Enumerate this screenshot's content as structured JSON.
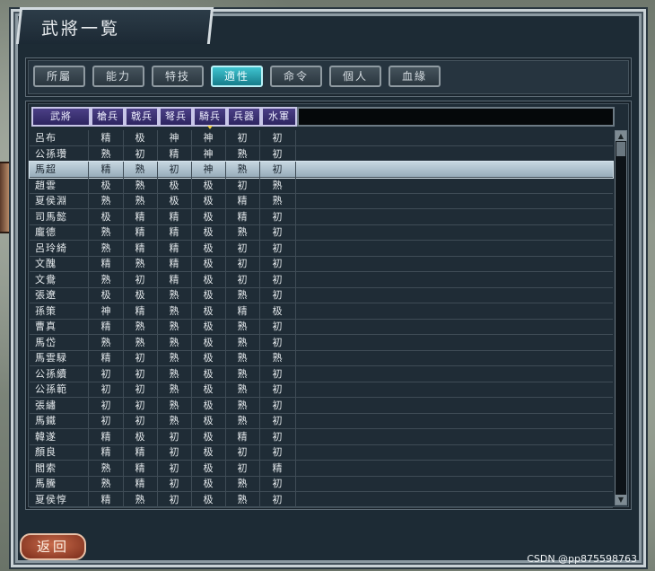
{
  "title": "武將一覧",
  "tabs": [
    {
      "label": "所屬",
      "active": false
    },
    {
      "label": "能力",
      "active": false
    },
    {
      "label": "特技",
      "active": false
    },
    {
      "label": "適性",
      "active": true
    },
    {
      "label": "命令",
      "active": false
    },
    {
      "label": "個人",
      "active": false
    },
    {
      "label": "血緣",
      "active": false
    }
  ],
  "table": {
    "columns": [
      "武將",
      "槍兵",
      "戟兵",
      "弩兵",
      "騎兵",
      "兵器",
      "水軍"
    ],
    "sorted_column": 4,
    "selected_row": 2,
    "rows": [
      [
        "呂布",
        "精",
        "极",
        "神",
        "神",
        "初",
        "初"
      ],
      [
        "公孫瓚",
        "熟",
        "初",
        "精",
        "神",
        "熟",
        "初"
      ],
      [
        "馬超",
        "精",
        "熟",
        "初",
        "神",
        "熟",
        "初"
      ],
      [
        "趙雲",
        "极",
        "熟",
        "极",
        "极",
        "初",
        "熟"
      ],
      [
        "夏侯淵",
        "熟",
        "熟",
        "极",
        "极",
        "精",
        "熟"
      ],
      [
        "司馬懿",
        "极",
        "精",
        "精",
        "极",
        "精",
        "初"
      ],
      [
        "龐德",
        "熟",
        "精",
        "精",
        "极",
        "熟",
        "初"
      ],
      [
        "呂玲綺",
        "熟",
        "精",
        "精",
        "极",
        "初",
        "初"
      ],
      [
        "文醜",
        "精",
        "熟",
        "精",
        "极",
        "初",
        "初"
      ],
      [
        "文鴦",
        "熟",
        "初",
        "精",
        "极",
        "初",
        "初"
      ],
      [
        "張遼",
        "极",
        "极",
        "熟",
        "极",
        "熟",
        "初"
      ],
      [
        "孫策",
        "神",
        "精",
        "熟",
        "极",
        "精",
        "极"
      ],
      [
        "曹真",
        "精",
        "熟",
        "熟",
        "极",
        "熟",
        "初"
      ],
      [
        "馬岱",
        "熟",
        "熟",
        "熟",
        "极",
        "熟",
        "初"
      ],
      [
        "馬雲騄",
        "精",
        "初",
        "熟",
        "极",
        "熟",
        "熟"
      ],
      [
        "公孫續",
        "初",
        "初",
        "熟",
        "极",
        "熟",
        "初"
      ],
      [
        "公孫範",
        "初",
        "初",
        "熟",
        "极",
        "熟",
        "初"
      ],
      [
        "張繡",
        "初",
        "初",
        "熟",
        "极",
        "熟",
        "初"
      ],
      [
        "馬鐵",
        "初",
        "初",
        "熟",
        "极",
        "熟",
        "初"
      ],
      [
        "韓遂",
        "精",
        "极",
        "初",
        "极",
        "精",
        "初"
      ],
      [
        "顏良",
        "精",
        "精",
        "初",
        "极",
        "初",
        "初"
      ],
      [
        "閻索",
        "熟",
        "精",
        "初",
        "极",
        "初",
        "精"
      ],
      [
        "馬騰",
        "熟",
        "精",
        "初",
        "极",
        "熟",
        "初"
      ],
      [
        "夏侯惇",
        "精",
        "熟",
        "初",
        "极",
        "熟",
        "初"
      ]
    ]
  },
  "back_label": "返回",
  "watermark": "CSDN @pp875598763",
  "icons": {
    "scroll_up": "▲",
    "scroll_down": "▼"
  },
  "colors": {
    "active_tab": "#2fb0bd",
    "header": "#3b3276",
    "selected_row": "#b3c5d1"
  }
}
